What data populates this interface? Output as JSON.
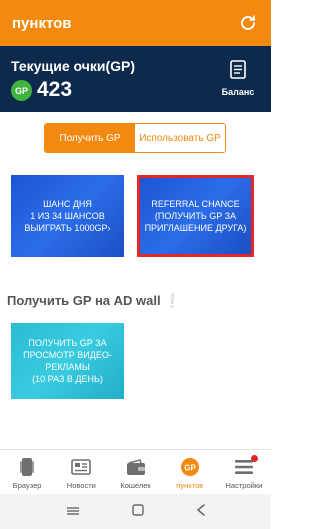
{
  "header": {
    "title": "пунктов"
  },
  "points": {
    "label": "Текущие очки(GP)",
    "badge": "GP",
    "value": "423",
    "balance_label": "Баланс"
  },
  "tabs": {
    "earn": "Получить GP",
    "use": "Использовать GP"
  },
  "cards": {
    "daily_chance": "ШАНС ДНЯ\n1 ИЗ 34 ШАНСОВ\nВЫИГРАТЬ 1000GP›",
    "referral_chance": "REFERRAL CHANCE\n(ПОЛУЧИТЬ GP ЗА\nПРИГЛАШЕНИЕ ДРУГА)",
    "video_ads": "ПОЛУЧИТЬ GP ЗА\nПРОСМОТР ВИДЕО-\nРЕКЛАМЫ\n(10 РАЗ В ДЕНЬ)"
  },
  "section": {
    "ad_wall_title": "Получить GP на AD wall",
    "ad_wall_emoji": "❕"
  },
  "nav": {
    "items": [
      {
        "label": "Браузер",
        "icon": "browser-icon"
      },
      {
        "label": "Новости",
        "icon": "news-icon"
      },
      {
        "label": "Кошелек",
        "icon": "wallet-icon"
      },
      {
        "label": "пунктов",
        "icon": "gp-points-icon",
        "active": true
      },
      {
        "label": "Настройки",
        "icon": "menu-icon"
      }
    ]
  },
  "colors": {
    "accent": "#f28a12",
    "header_dark": "#0d2a4d",
    "card_blue": "#1d55d1",
    "card_cyan": "#29bcd3",
    "selected_border": "#e3262a",
    "gp_green": "#3fb43f"
  }
}
